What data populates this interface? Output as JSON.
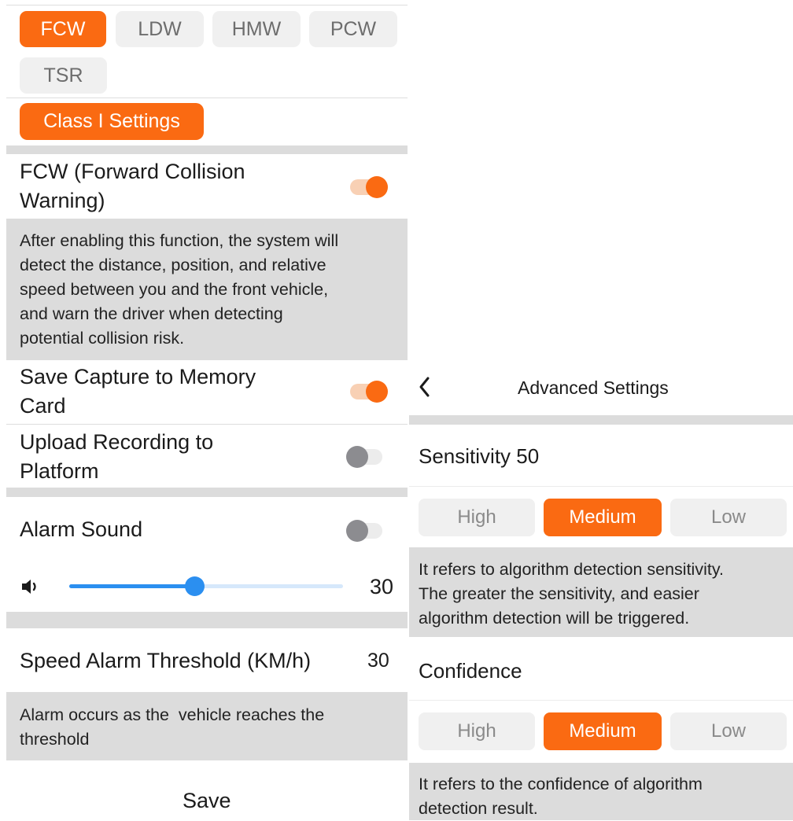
{
  "left": {
    "tabs": [
      {
        "label": "FCW",
        "active": true
      },
      {
        "label": "LDW",
        "active": false
      },
      {
        "label": "HMW",
        "active": false
      },
      {
        "label": "PCW",
        "active": false
      },
      {
        "label": "TSR",
        "active": false
      }
    ],
    "class_button": "Class I Settings",
    "fcw": {
      "title_line1": "FCW (Forward Collision",
      "title_line2": "Warning)",
      "enabled": true,
      "desc_lines": [
        "After enabling this function, the system will",
        "detect the distance, position, and relative",
        "speed between you and the front vehicle,",
        "and warn the driver when detecting",
        "potential collision risk."
      ]
    },
    "save_capture": {
      "line1": "Save Capture to Memory",
      "line2": "Card",
      "enabled": true
    },
    "upload_recording": {
      "line1": "Upload Recording to",
      "line2": "Platform",
      "enabled": false
    },
    "alarm_sound": {
      "label": "Alarm Sound",
      "enabled": false,
      "volume": 30,
      "volume_max": 100
    },
    "speed_threshold": {
      "label": "Speed Alarm Threshold (KM/h)",
      "value": "30",
      "desc_lines": [
        "Alarm occurs as the  vehicle reaches the",
        "threshold"
      ]
    },
    "save_label": "Save"
  },
  "right": {
    "header": {
      "back_icon": "chevron-left-icon",
      "title": "Advanced Settings"
    },
    "sensitivity": {
      "label": "Sensitivity 50",
      "options": [
        "High",
        "Medium",
        "Low"
      ],
      "selected": "Medium",
      "desc_lines": [
        "It refers to algorithm detection sensitivity.",
        "The greater the sensitivity, and easier",
        "algorithm detection will be triggered."
      ]
    },
    "confidence": {
      "label": "Confidence",
      "options": [
        "High",
        "Medium",
        "Low"
      ],
      "selected": "Medium",
      "desc_lines": [
        "It refers to the confidence of algorithm",
        "detection result."
      ]
    }
  },
  "colors": {
    "accent": "#fa6a12",
    "slider": "#2b8ff0",
    "divider": "#dcdcdc"
  }
}
